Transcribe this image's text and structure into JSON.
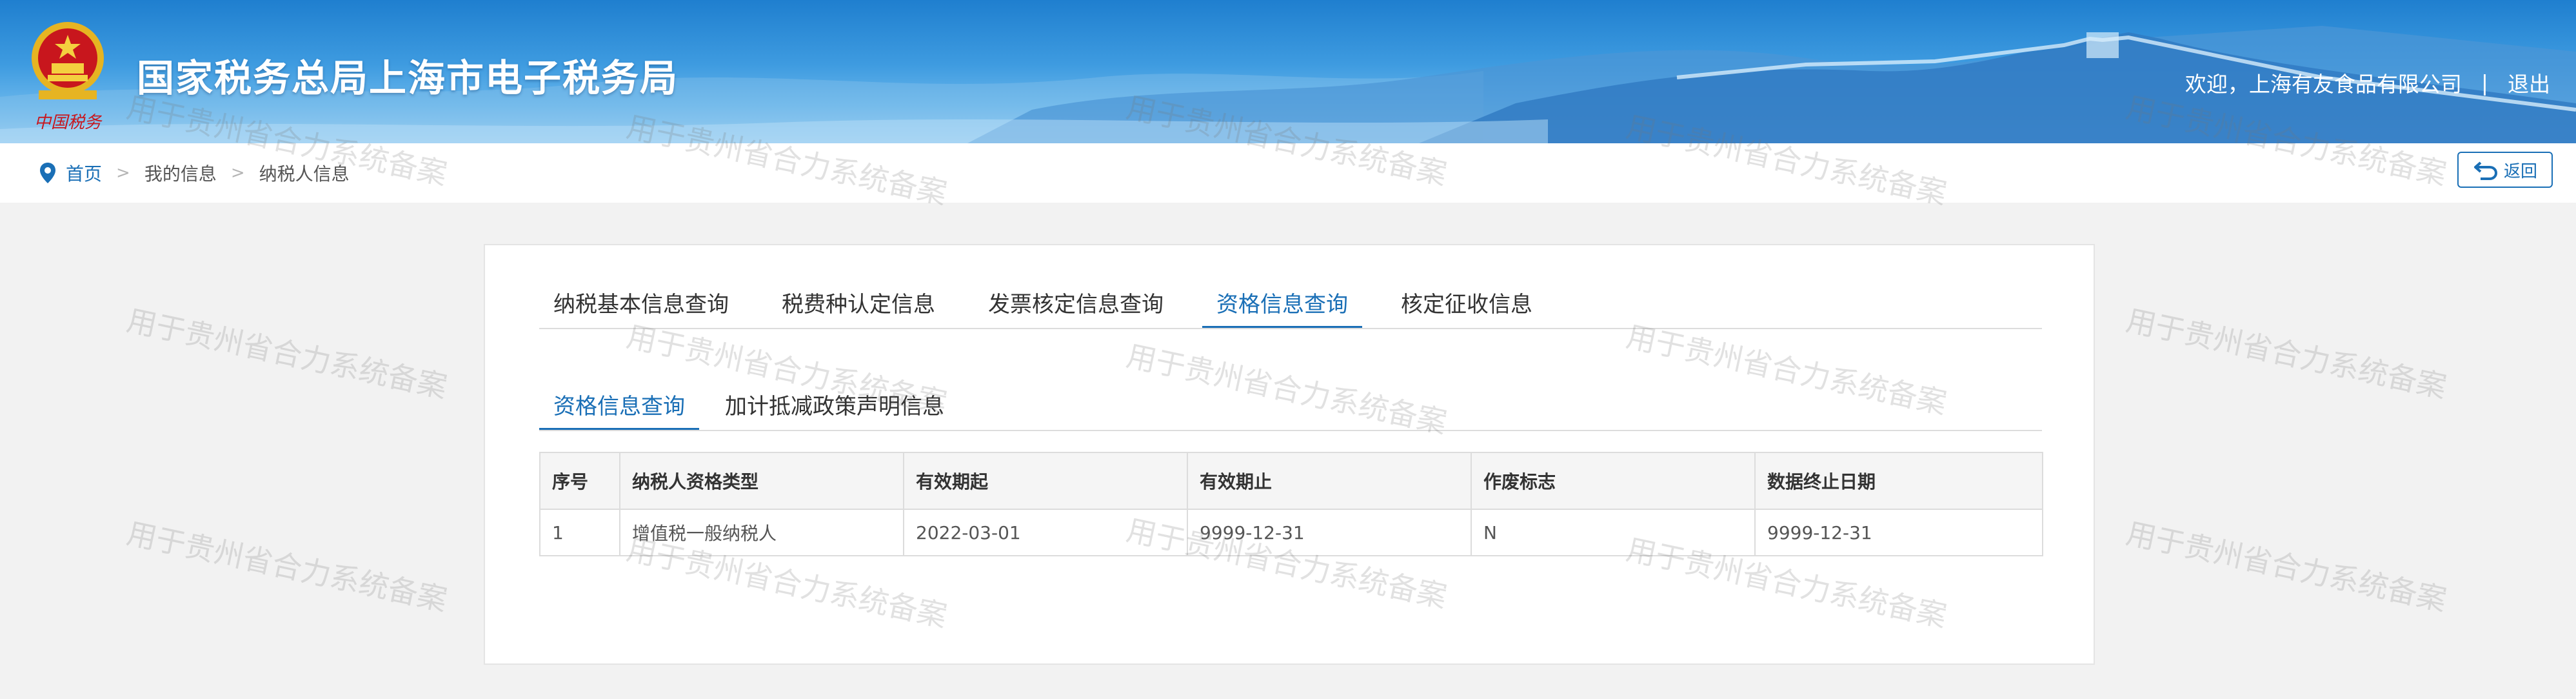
{
  "header": {
    "site_title": "国家税务总局上海市电子税务局",
    "emblem_caption": "中国税务",
    "welcome": "欢迎，上海有友食品有限公司",
    "separator": "|",
    "logout": "退出"
  },
  "breadcrumb": {
    "home": "首页",
    "items": [
      "我的信息",
      "纳税人信息"
    ],
    "separator": ">",
    "back_label": "返回"
  },
  "main_tabs": [
    {
      "label": "纳税基本信息查询",
      "active": false
    },
    {
      "label": "税费种认定信息",
      "active": false
    },
    {
      "label": "发票核定信息查询",
      "active": false
    },
    {
      "label": "资格信息查询",
      "active": true
    },
    {
      "label": "核定征收信息",
      "active": false
    }
  ],
  "sub_tabs": [
    {
      "label": "资格信息查询",
      "active": true
    },
    {
      "label": "加计抵减政策声明信息",
      "active": false
    }
  ],
  "table": {
    "columns": [
      "序号",
      "纳税人资格类型",
      "有效期起",
      "有效期止",
      "作废标志",
      "数据终止日期"
    ],
    "rows": [
      [
        "1",
        "增值税一般纳税人",
        "2022-03-01",
        "9999-12-31",
        "N",
        "9999-12-31"
      ]
    ]
  },
  "watermark": "用于贵州省合力系统备案",
  "colors": {
    "accent": "#1a6fb6",
    "header_top": "#1f7fcf",
    "emblem_red": "#c8161d",
    "emblem_gold": "#e6b422"
  }
}
